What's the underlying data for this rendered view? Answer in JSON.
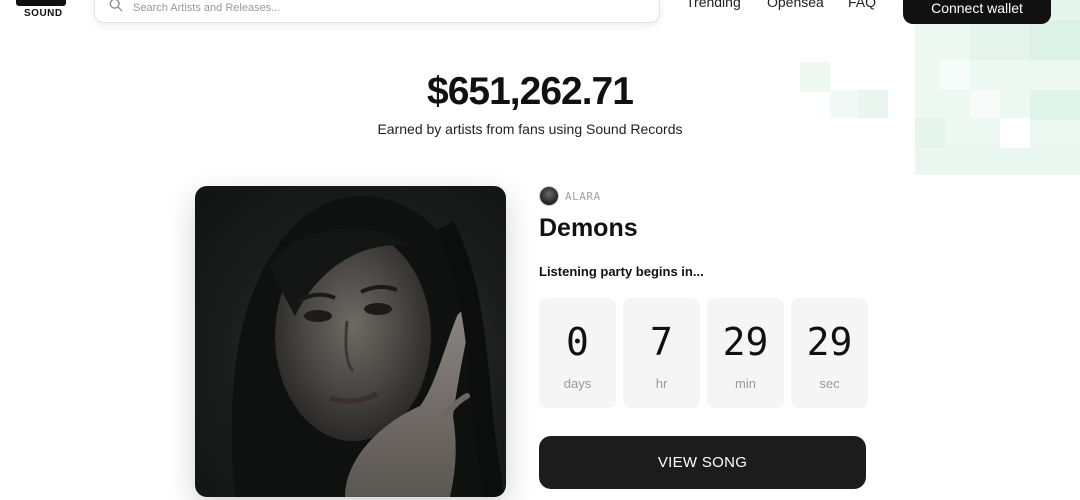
{
  "header": {
    "logo_text": "SOUND",
    "search_placeholder": "Search Artists and Releases...",
    "nav": [
      "Trending",
      "Opensea",
      "FAQ"
    ],
    "connect_label": "Connect wallet"
  },
  "hero": {
    "total_earned": "$651,262.71",
    "subtitle": "Earned by artists from fans using Sound Records"
  },
  "release": {
    "artist": "ALARA",
    "title": "Demons",
    "party_text": "Listening party begins in...",
    "countdown": [
      {
        "value": "0",
        "unit": "days"
      },
      {
        "value": "7",
        "unit": "hr"
      },
      {
        "value": "29",
        "unit": "min"
      },
      {
        "value": "29",
        "unit": "sec"
      }
    ],
    "cta_label": "VIEW SONG"
  },
  "colors": {
    "primary_dark": "#111111",
    "muted_text": "#9a9a9a",
    "countdown_bg": "#f5f5f5",
    "mosaic_accent": "#e2f4ec"
  }
}
